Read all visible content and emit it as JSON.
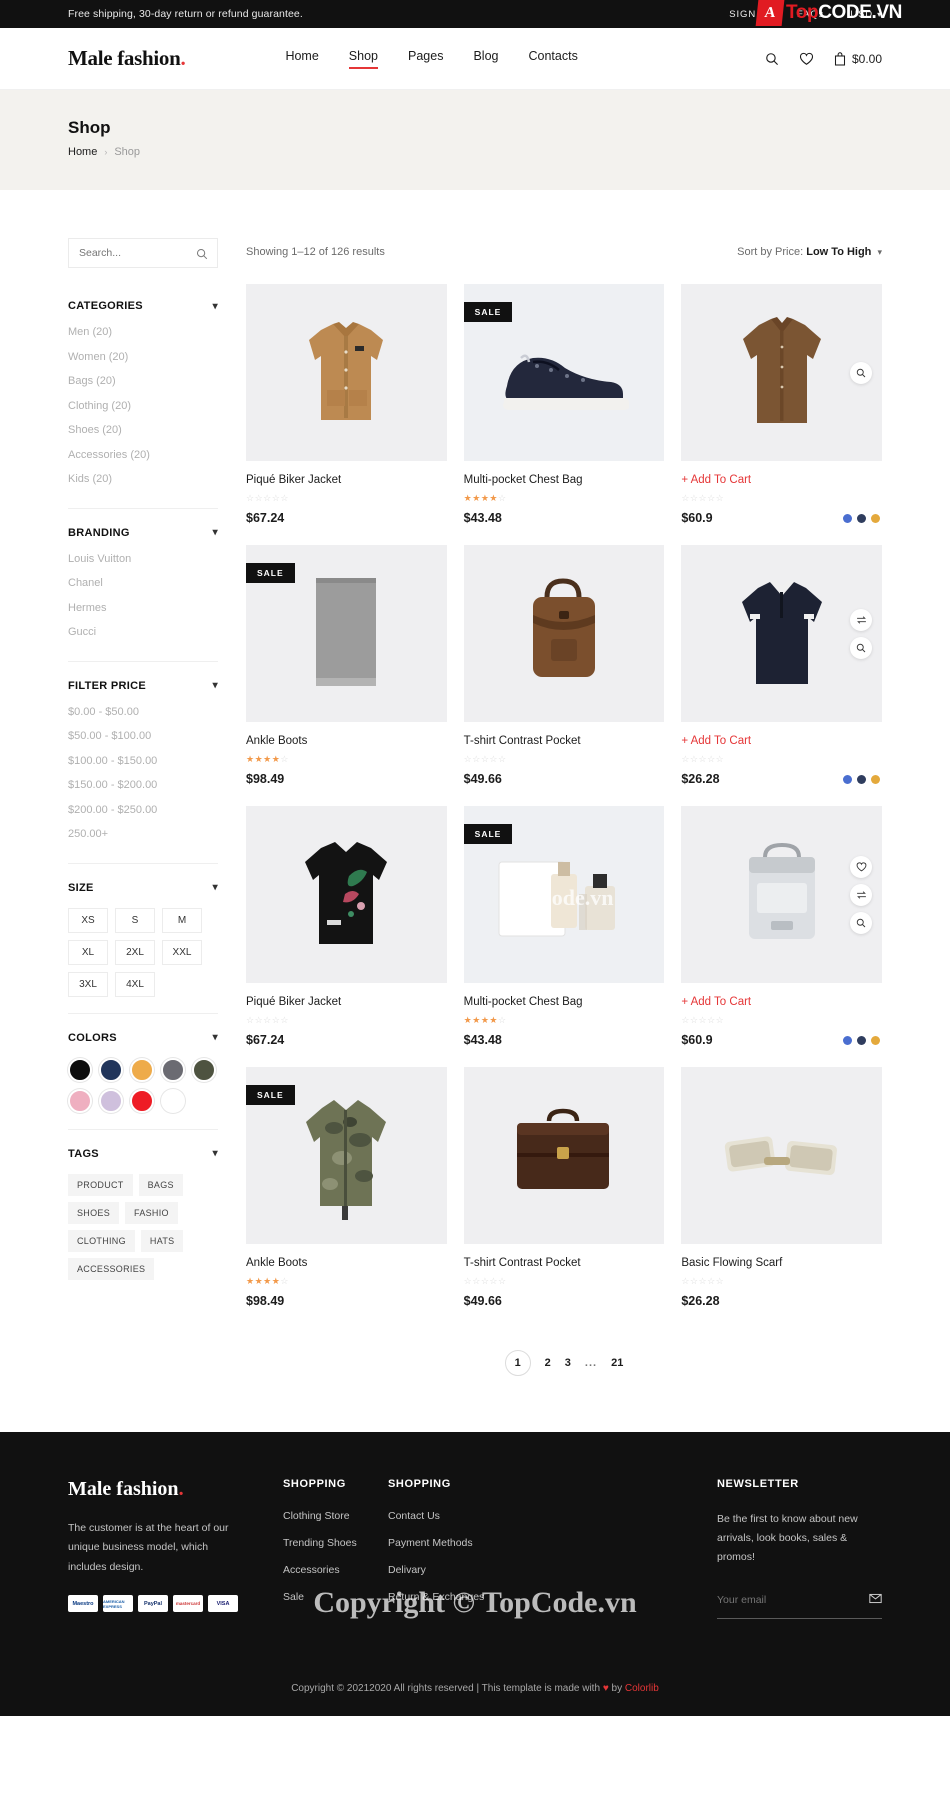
{
  "topbar": {
    "promo": "Free shipping, 30-day return or refund guarantee.",
    "sign_in": "SIGN IN",
    "faqs": "FAQs",
    "currency": "USD",
    "watermark_a": "Top",
    "watermark_b": "CODE.VN",
    "watermark_badge": "A"
  },
  "header": {
    "logo": "Male fashion",
    "logo_dot": ".",
    "nav": [
      {
        "label": "Home",
        "active": false
      },
      {
        "label": "Shop",
        "active": true
      },
      {
        "label": "Pages",
        "active": false
      },
      {
        "label": "Blog",
        "active": false
      },
      {
        "label": "Contacts",
        "active": false
      }
    ],
    "cart_total": "$0.00"
  },
  "banner": {
    "title": "Shop",
    "crumb_home": "Home",
    "crumb_sep": "›",
    "crumb_current": "Shop"
  },
  "sidebar": {
    "search_placeholder": "Search...",
    "sections": [
      {
        "title": "CATEGORIES",
        "items": [
          "Men (20)",
          "Women (20)",
          "Bags (20)",
          "Clothing (20)",
          "Shoes (20)",
          "Accessories (20)",
          "Kids (20)"
        ]
      },
      {
        "title": "BRANDING",
        "items": [
          "Louis Vuitton",
          "Chanel",
          "Hermes",
          "Gucci"
        ]
      },
      {
        "title": "FILTER PRICE",
        "items": [
          "$0.00 - $50.00",
          "$50.00 - $100.00",
          "$100.00 - $150.00",
          "$150.00 - $200.00",
          "$200.00 - $250.00",
          "250.00+"
        ]
      }
    ],
    "size": {
      "title": "SIZE",
      "options": [
        "XS",
        "S",
        "M",
        "XL",
        "2XL",
        "XXL",
        "3XL",
        "4XL"
      ]
    },
    "colors": {
      "title": "COLORS",
      "swatches": [
        {
          "name": "black",
          "hex": "#0d0d0d"
        },
        {
          "name": "navy",
          "hex": "#21355b"
        },
        {
          "name": "yellow",
          "hex": "#eeab4a"
        },
        {
          "name": "grey",
          "hex": "#6b6b72"
        },
        {
          "name": "olive",
          "hex": "#4e5340"
        },
        {
          "name": "pink",
          "hex": "#efafc0"
        },
        {
          "name": "lavender",
          "hex": "#cfc0dd"
        },
        {
          "name": "red",
          "hex": "#ee1c25"
        },
        {
          "name": "white",
          "hex": "#ffffff"
        }
      ]
    },
    "tags": {
      "title": "TAGS",
      "items": [
        "PRODUCT",
        "BAGS",
        "SHOES",
        "FASHIO",
        "CLOTHING",
        "HATS",
        "ACCESSORIES"
      ]
    }
  },
  "toolbar": {
    "showing": "Showing 1–12 of 126 results",
    "sort_prefix": "Sort by Price:",
    "sort_value": "Low To High"
  },
  "products": [
    {
      "name": "Piqué Biker Jacket",
      "price": "$67.24",
      "rating": 0,
      "sale": false,
      "add_to_cart": false,
      "kind": "jacket-tan",
      "dots": []
    },
    {
      "name": "Multi-pocket Chest Bag",
      "price": "$43.48",
      "rating": 4,
      "sale": true,
      "add_to_cart": false,
      "kind": "sneaker-navy",
      "dots": []
    },
    {
      "name": "+ Add To Cart",
      "price": "$60.9",
      "rating": 0,
      "sale": false,
      "add_to_cart": true,
      "kind": "shirt-brown",
      "dots": [
        "#4a6ed0",
        "#2f3d5e",
        "#e4a93c"
      ]
    },
    {
      "name": "Ankle Boots",
      "price": "$98.49",
      "rating": 4,
      "sale": true,
      "add_to_cart": false,
      "kind": "scarf-grey",
      "dots": []
    },
    {
      "name": "T-shirt Contrast Pocket",
      "price": "$49.66",
      "rating": 0,
      "sale": false,
      "add_to_cart": false,
      "kind": "backpack-brown",
      "dots": []
    },
    {
      "name": "+ Add To Cart",
      "price": "$26.28",
      "rating": 0,
      "sale": false,
      "add_to_cart": true,
      "kind": "polo-navy",
      "dots": [
        "#4a6ed0",
        "#2f3d5e",
        "#e4a93c"
      ]
    },
    {
      "name": "Piqué Biker Jacket",
      "price": "$67.24",
      "rating": 0,
      "sale": false,
      "add_to_cart": false,
      "kind": "tee-black",
      "dots": []
    },
    {
      "name": "Multi-pocket Chest Bag",
      "price": "$43.48",
      "rating": 4,
      "sale": true,
      "add_to_cart": false,
      "kind": "perfume",
      "dots": []
    },
    {
      "name": "+ Add To Cart",
      "price": "$60.9",
      "rating": 0,
      "sale": false,
      "add_to_cart": true,
      "kind": "bag-white",
      "dots": [
        "#4a6ed0",
        "#2f3d5e",
        "#e4a93c"
      ]
    },
    {
      "name": "Ankle Boots",
      "price": "$98.49",
      "rating": 4,
      "sale": true,
      "add_to_cart": false,
      "kind": "camo-jacket",
      "dots": []
    },
    {
      "name": "T-shirt Contrast Pocket",
      "price": "$49.66",
      "rating": 0,
      "sale": false,
      "add_to_cart": false,
      "kind": "briefcase",
      "dots": []
    },
    {
      "name": "Basic Flowing Scarf",
      "price": "$26.28",
      "rating": 0,
      "sale": false,
      "add_to_cart": false,
      "kind": "cufflinks",
      "dots": []
    }
  ],
  "pagination": {
    "pages": [
      "1",
      "2",
      "3",
      "...",
      "21"
    ],
    "active": "1"
  },
  "footer": {
    "logo": "Male fashion",
    "logo_dot": ".",
    "description": "The customer is at the heart of our unique business model, which includes design.",
    "payments": [
      "Maestro",
      "AMERICAN EXPRESS",
      "PayPal",
      "mastercard",
      "VISA"
    ],
    "columns": [
      {
        "title": "SHOPPING",
        "items": [
          "Clothing Store",
          "Trending Shoes",
          "Accessories",
          "Sale"
        ]
      },
      {
        "title": "SHOPPING",
        "items": [
          "Contact Us",
          "Payment Methods",
          "Delivary",
          "Return & Exchanges"
        ]
      }
    ],
    "newsletter": {
      "title": "NEWSLETTER",
      "text": "Be the first to know about new arrivals, look books, sales & promos!",
      "placeholder": "Your email"
    },
    "copyright_pre": "Copyright © 20212020 All rights reserved | This template is made with ",
    "copyright_heart": "♥",
    "copyright_by": " by ",
    "copyright_brand": "Colorlib",
    "watermark": "Copyright © TopCode.vn",
    "watermark_mid": "TopCode.vn"
  }
}
